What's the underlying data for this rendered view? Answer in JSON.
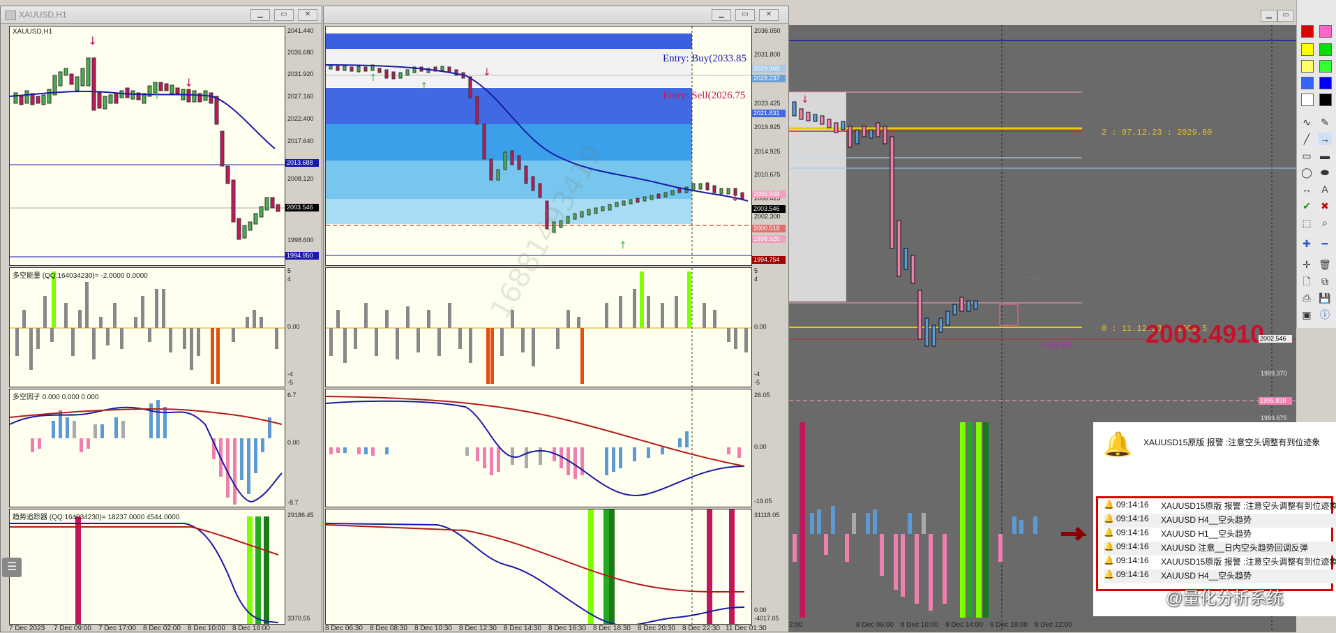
{
  "window1": {
    "title": "XAUUSD,H1",
    "symbol_label": "XAUUSD,H1",
    "price_ticks": [
      "2041.440",
      "2036.680",
      "2031.920",
      "2027.160",
      "2022.400",
      "2017.640",
      "2012.880",
      "2008.120",
      "2003.360",
      "1998.600",
      "1993.840"
    ],
    "tag_blue": "2013.688",
    "tag_current": "2003.546",
    "tag_low": "1994.950",
    "ind1_label": "多空能量 (QQ:164034230)=   -2.0000  0.0000",
    "ind1_ticks": [
      "5",
      "4",
      "0.00",
      "-4",
      "-5"
    ],
    "ind2_label": "多空因子 0.000  0.000  0.000",
    "ind2_ticks": [
      "6.7",
      "0.00",
      "-8.7"
    ],
    "ind3_label": "趋势追踪器 (QQ:164034230)=   18237.0000  4544.0000",
    "ind3_ticks": [
      "29186.45",
      "3370.55"
    ],
    "dates": [
      "7 Dec 2023",
      "7 Dec 09:00",
      "7 Dec 17:00",
      "8 Dec 02:00",
      "8 Dec 10:00",
      "8 Dec 18:00"
    ]
  },
  "window2": {
    "price_ticks": [
      "2036.050",
      "2031.800",
      "2027.550",
      "2023.425",
      "2019.925",
      "2014.925",
      "2010.675",
      "2006.425",
      "2002.300",
      "1998.050",
      "1993.925"
    ],
    "tags": [
      "2029.968",
      "2028.237",
      "2021.831",
      "2006.948",
      "2003.546",
      "2000.518",
      "1998.926",
      "1994.754"
    ],
    "entry_buy": "Entry: Buy(2033.85",
    "entry_sell": "Entry: Sell(2026.75",
    "ind1_ticks": [
      "5",
      "4",
      "0.00",
      "-4",
      "-5"
    ],
    "ind2_ticks": [
      "26.05",
      "0.00",
      "-19.05"
    ],
    "ind3_ticks": [
      "31118.05",
      "0.00",
      "-4017.05"
    ],
    "dates": [
      "8 Dec 06:30",
      "8 Dec 08:30",
      "8 Dec 10:30",
      "8 Dec 12:30",
      "8 Dec 14:30",
      "8 Dec 16:30",
      "8 Dec 18:30",
      "8 Dec 20:30",
      "8 Dec 22:30",
      "11 Dec 01:30"
    ],
    "watermark": "16881493419"
  },
  "window3": {
    "level2_text": "2 : 07.12.23 : 2029.60",
    "level0_text": "0 : 11.12.23 : 2003.5",
    "big_price": "2003.4910",
    "countdown": "<15:52",
    "price_ticks": [
      "2002.546",
      "1999.370",
      "1995.838",
      "1993.675"
    ],
    "dates": [
      "2:00",
      "8 Dec 06:00",
      "8 Dec 10:00",
      "8 Dec 14:00",
      "8 Dec 18:00",
      "8 Dec 22:00"
    ]
  },
  "alert": {
    "headline": "XAUUSD15原版  报警 :注意空头调整有到位迹象",
    "rows": [
      {
        "time": "09:14:16",
        "text": "XAUUSD15原版  报警 :注意空头调整有到位迹象"
      },
      {
        "time": "09:14:16",
        "text": "XAUUSD  H4__空头趋势"
      },
      {
        "time": "09:14:16",
        "text": "XAUUSD  H1__空头趋势"
      },
      {
        "time": "09:14:16",
        "text": "XAUUSD  注意__日内空头趋势回调反弹"
      },
      {
        "time": "09:14:16",
        "text": "XAUUSD15原版  报警 :注意空头调整有到位迹象"
      },
      {
        "time": "09:14:16",
        "text": "XAUUSD  H4__空头趋势"
      }
    ],
    "branding": "@量化分析系统"
  },
  "colors": {
    "chart_bg": "#fffff0",
    "dark_bg": "#666666",
    "bull": "#4caf50",
    "bear": "#c2185b",
    "ma": "#1a1aa8",
    "alert_border": "#e00000",
    "big_price": "#c8102e"
  }
}
